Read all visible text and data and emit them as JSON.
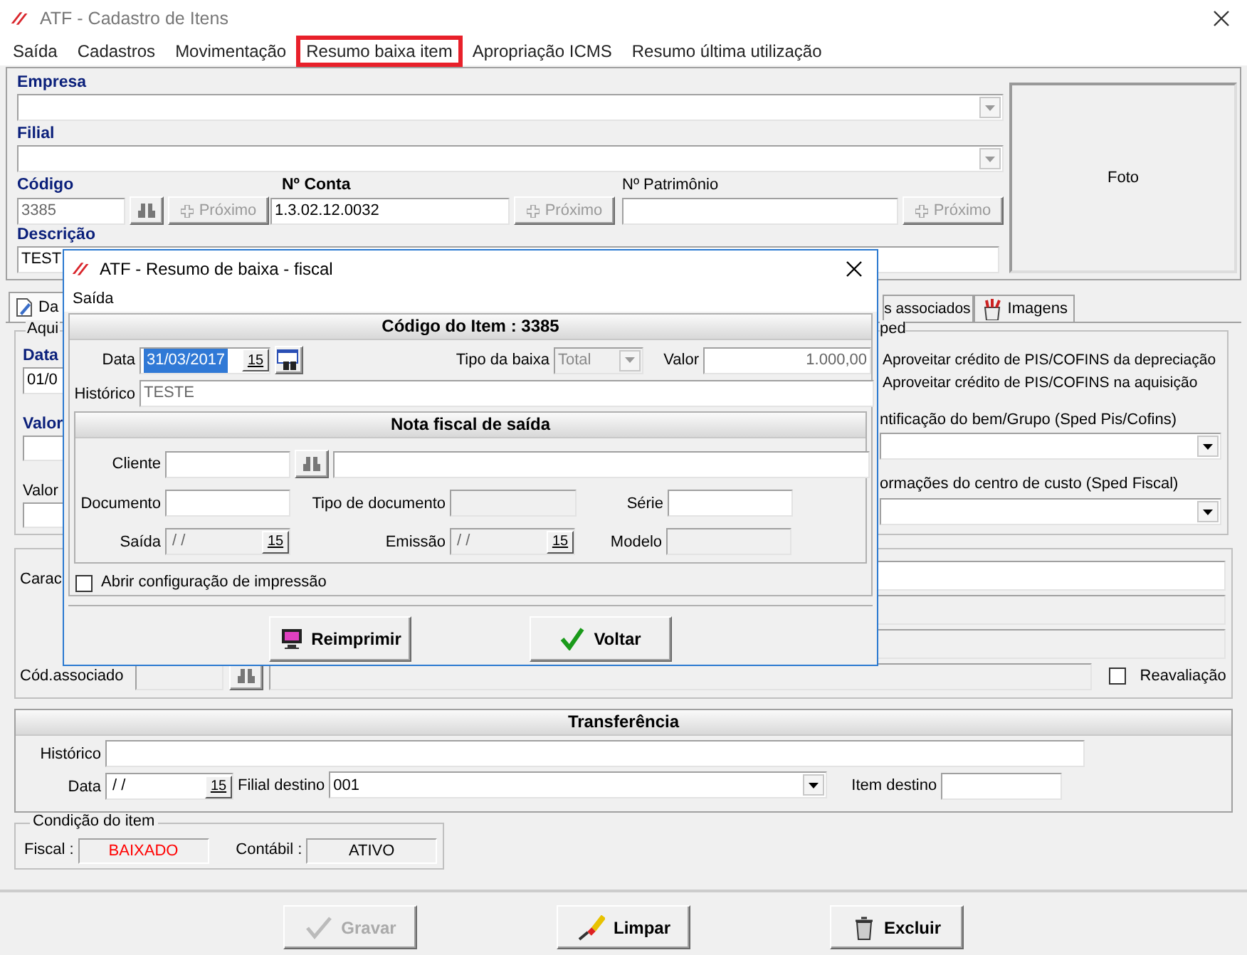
{
  "window": {
    "title": "ATF - Cadastro de Itens"
  },
  "menu": [
    {
      "label": "Saída",
      "highlighted": false
    },
    {
      "label": "Cadastros",
      "highlighted": false
    },
    {
      "label": "Movimentação",
      "highlighted": false
    },
    {
      "label": "Resumo baixa item",
      "highlighted": true
    },
    {
      "label": "Apropriação ICMS",
      "highlighted": false
    },
    {
      "label": "Resumo última utilização",
      "highlighted": false
    }
  ],
  "empresa": {
    "label": "Empresa"
  },
  "filial": {
    "label": "Filial"
  },
  "codigo": {
    "label": "Código",
    "value": "3385",
    "next_button": "Próximo"
  },
  "conta": {
    "label": "Nº Conta",
    "value": "1.3.02.12.0032",
    "next_button": "Próximo"
  },
  "patrimonio": {
    "label": "Nº Patrimônio",
    "next_button": "Próximo"
  },
  "descricao": {
    "label": "Descrição",
    "value": "TEST"
  },
  "photo": {
    "label": "Foto"
  },
  "tabs": [
    {
      "label": "Da",
      "selected": true
    },
    {
      "label": "s associados",
      "selected": false
    },
    {
      "label": "Imagens",
      "selected": false
    }
  ],
  "acquisition": {
    "legend": "Aqui",
    "date_label": "Data",
    "date_value": "01/0",
    "value_label": "Valor",
    "value2_label": "Valor"
  },
  "sped": {
    "legend": "ped",
    "options": [
      "Aproveitar crédito de PIS/COFINS da depreciação",
      "Aproveitar crédito de PIS/COFINS na aquisição"
    ],
    "combo1_label": "ntificação do bem/Grupo (Sped Pis/Cofins)",
    "combo2_label": "ormações do centro de custo (Sped Fiscal)"
  },
  "characteristics": {
    "label": "Carac",
    "assoc_label": "Cód.associado",
    "revaluation": {
      "label": "Reavaliação",
      "checked": false
    }
  },
  "transfer": {
    "title": "Transferência",
    "history_label": "Histórico",
    "date_label": "Data",
    "date_value": "/ /",
    "calendar": "15",
    "branch_label": "Filial destino",
    "branch_value": "001",
    "item_label": "Item destino"
  },
  "condition": {
    "legend": "Condição do item",
    "statuses": [
      {
        "label": "Fiscal :",
        "value": "BAIXADO",
        "color": "#ff0000"
      },
      {
        "label": "Contábil :",
        "value": "ATIVO",
        "color": "#000000"
      }
    ]
  },
  "buttons": [
    {
      "label": "Gravar",
      "kind": "save",
      "disabled": true
    },
    {
      "label": "Limpar",
      "kind": "clear",
      "disabled": false
    },
    {
      "label": "Excluir",
      "kind": "delete",
      "disabled": false
    }
  ],
  "dialog": {
    "title": "ATF - Resumo de baixa - fiscal",
    "menu": [
      "Saída"
    ],
    "header": "Código do Item : 3385",
    "date": {
      "label": "Data",
      "value": "31/03/2017",
      "text_selected": true,
      "calendar": "15"
    },
    "type": {
      "label": "Tipo da baixa",
      "value": "Total",
      "disabled": true
    },
    "amount": {
      "label": "Valor",
      "value": "1.000,00"
    },
    "history": {
      "label": "Histórico",
      "value": "TESTE"
    },
    "invoice": {
      "title": "Nota fiscal de saída",
      "client_label": "Cliente",
      "document_label": "Documento",
      "doc_type_label": "Tipo de documento",
      "series_label": "Série",
      "exit": {
        "label": "Saída",
        "value": "/ /",
        "calendar": "15"
      },
      "issue": {
        "label": "Emissão",
        "value": "/ /",
        "calendar": "15"
      },
      "model_label": "Modelo"
    },
    "print_option": {
      "label": "Abrir configuração de impressão",
      "checked": false
    },
    "buttons": [
      {
        "label": "Reimprimir",
        "kind": "print"
      },
      {
        "label": "Voltar",
        "kind": "back"
      }
    ]
  }
}
